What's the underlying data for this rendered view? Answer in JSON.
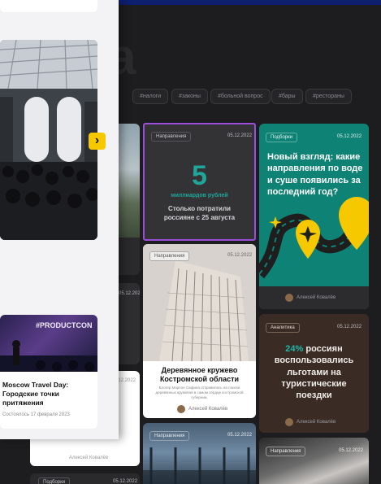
{
  "filters": [
    "#налоги",
    "#законы",
    "#больной вопрос",
    "#бары",
    "#рестораны"
  ],
  "brand_letter": "a",
  "card_stat": {
    "tag": "Направления",
    "date": "05.12.2022",
    "big_number": "5",
    "unit": "миллиардов рублей",
    "caption": "Столько потратили россияне с 25 августа"
  },
  "card_green": {
    "tag": "Подборки",
    "date": "05.12.2022",
    "title": "Новый взгляд: какие направления по воде и суше появились за последний год?",
    "author": "Алексей Ковалёв"
  },
  "card_building": {
    "tag": "Направления",
    "date": "05.12.2022",
    "title": "Деревянное кружево Костромской области",
    "excerpt": "Блогер Марсон Сафина отправилась на поиски деревянных кружевов в самом сердце костромской губернии.",
    "author": "Алексей Ковалёв"
  },
  "card_analytics": {
    "tag": "Аналитика",
    "date": "05.12.2022",
    "highlight": "24%",
    "title_rest": " россиян воспользовались льготами на туристические поездки",
    "author": "Алексей Ковалёв"
  },
  "card_airport": {
    "tag": "Направления",
    "date": "05.12.2022"
  },
  "card_hand": {
    "tag": "Направления",
    "date": "05.12.2022"
  },
  "col1_dates": [
    "05.12.2022",
    "05.12.2022"
  ],
  "col1_author": "Алексей Ковалёв",
  "col1_tag": "Подборки",
  "panel": {
    "arrow": "›",
    "event_banner": "#PRODUCTCON",
    "event_title": "Moscow Travel Day: Городские точки притяжения",
    "event_meta": "Состоялось 17 февраля 2023"
  }
}
